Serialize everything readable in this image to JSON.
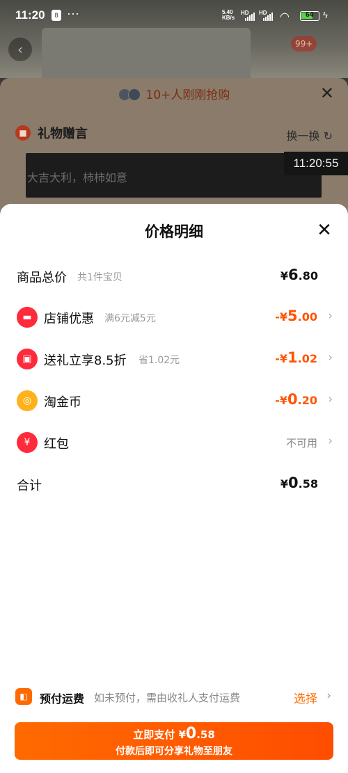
{
  "status_bar": {
    "time": "11:20",
    "app_badge": "8",
    "more": "···",
    "net_speed_top": "5.40",
    "net_speed_bottom": "KB/s",
    "sig1": "HD",
    "sig2": "HD",
    "battery": "64"
  },
  "background": {
    "back_icon": "‹",
    "badge": "99+"
  },
  "gift_sheet": {
    "header": "10+人刚刚抢购",
    "close": "✕",
    "title_icon": "gift-icon",
    "title": "礼物赠言",
    "swap": "换一换",
    "swap_icon": "refresh-icon",
    "message_placeholder": "大吉大利，柿柿如意",
    "timestamp": "11:20:55"
  },
  "price_detail": {
    "title": "价格明细",
    "close": "✕",
    "rows": [
      {
        "label": "商品总价",
        "sub": "共1件宝贝",
        "yen": "¥",
        "int": "6",
        "dec": ".80"
      },
      {
        "label": "店铺优惠",
        "sub": "满6元减5元",
        "yen": "-¥",
        "int": "5",
        "dec": ".00",
        "icon": "shop-icon"
      },
      {
        "label": "送礼立享8.5折",
        "sub": "省1.02元",
        "yen": "-¥",
        "int": "1",
        "dec": ".02",
        "icon": "gift-icon"
      },
      {
        "label": "淘金币",
        "yen": "-¥",
        "int": "0",
        "dec": ".20",
        "icon": "coin-icon"
      },
      {
        "label": "红包",
        "status": "不可用",
        "icon": "red-envelope-icon"
      },
      {
        "label": "合计",
        "yen": "¥",
        "int": "0",
        "dec": ".58"
      }
    ]
  },
  "shipping": {
    "title": "预付运费",
    "desc": "如未预付，需由收礼人支付运费",
    "choose": "选择"
  },
  "pay_button": {
    "label": "立即支付",
    "yen": "¥",
    "int": "0",
    "dec": ".58",
    "sub": "付款后即可分享礼物至朋友"
  },
  "colors": {
    "accent": "#ff5500",
    "button": "#ff6a00"
  }
}
